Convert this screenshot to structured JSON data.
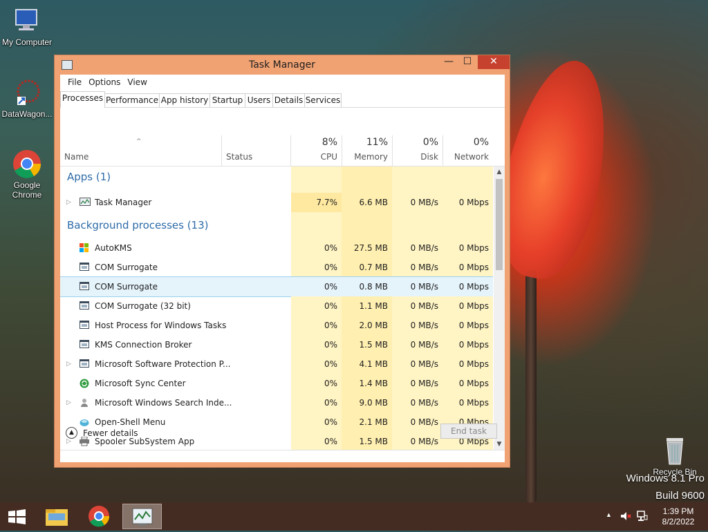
{
  "desktop": {
    "icons": [
      {
        "label": "My Computer",
        "icon": "monitor-icon"
      },
      {
        "label": "DataWagon...",
        "icon": "datawagon-icon"
      },
      {
        "label": "Google Chrome",
        "icon": "chrome-icon"
      },
      {
        "label": "Recycle Bin",
        "icon": "recycle-bin-icon"
      }
    ],
    "watermark": {
      "line1": "Windows 8.1 Pro",
      "line2": "Build 9600"
    }
  },
  "window": {
    "title": "Task Manager",
    "controls": {
      "minimize": "—",
      "maximize": "☐",
      "close": "✕"
    },
    "menu": [
      "File",
      "Options",
      "View"
    ],
    "tabs": [
      "Processes",
      "Performance",
      "App history",
      "Startup",
      "Users",
      "Details",
      "Services"
    ],
    "active_tab": "Processes",
    "columns": {
      "name": "Name",
      "status": "Status",
      "cpu": {
        "pct": "8%",
        "label": "CPU"
      },
      "memory": {
        "pct": "11%",
        "label": "Memory"
      },
      "disk": {
        "pct": "0%",
        "label": "Disk"
      },
      "network": {
        "pct": "0%",
        "label": "Network"
      }
    },
    "groups": [
      {
        "label": "Apps (1)",
        "rows": [
          {
            "name": "Task Manager",
            "expandable": true,
            "icon": "task-manager-icon",
            "cpu": "7.7%",
            "memory": "6.6 MB",
            "disk": "0 MB/s",
            "network": "0 Mbps"
          }
        ]
      },
      {
        "label": "Background processes (13)",
        "rows": [
          {
            "name": "AutoKMS",
            "expandable": false,
            "icon": "windows-logo-icon",
            "cpu": "0%",
            "memory": "27.5 MB",
            "disk": "0 MB/s",
            "network": "0 Mbps"
          },
          {
            "name": "COM Surrogate",
            "expandable": false,
            "icon": "process-window-icon",
            "cpu": "0%",
            "memory": "0.7 MB",
            "disk": "0 MB/s",
            "network": "0 Mbps"
          },
          {
            "name": "COM Surrogate",
            "expandable": false,
            "icon": "process-window-icon",
            "cpu": "0%",
            "memory": "0.8 MB",
            "disk": "0 MB/s",
            "network": "0 Mbps",
            "selected": true
          },
          {
            "name": "COM Surrogate (32 bit)",
            "expandable": false,
            "icon": "process-window-icon",
            "cpu": "0%",
            "memory": "1.1 MB",
            "disk": "0 MB/s",
            "network": "0 Mbps"
          },
          {
            "name": "Host Process for Windows Tasks",
            "expandable": false,
            "icon": "process-window-icon",
            "cpu": "0%",
            "memory": "2.0 MB",
            "disk": "0 MB/s",
            "network": "0 Mbps"
          },
          {
            "name": "KMS Connection Broker",
            "expandable": false,
            "icon": "process-window-icon",
            "cpu": "0%",
            "memory": "1.5 MB",
            "disk": "0 MB/s",
            "network": "0 Mbps"
          },
          {
            "name": "Microsoft Software Protection P...",
            "expandable": true,
            "icon": "process-window-icon",
            "cpu": "0%",
            "memory": "4.1 MB",
            "disk": "0 MB/s",
            "network": "0 Mbps"
          },
          {
            "name": "Microsoft Sync Center",
            "expandable": false,
            "icon": "sync-icon",
            "cpu": "0%",
            "memory": "1.4 MB",
            "disk": "0 MB/s",
            "network": "0 Mbps"
          },
          {
            "name": "Microsoft Windows Search Inde...",
            "expandable": true,
            "icon": "search-indexer-icon",
            "cpu": "0%",
            "memory": "9.0 MB",
            "disk": "0 MB/s",
            "network": "0 Mbps"
          },
          {
            "name": "Open-Shell Menu",
            "expandable": false,
            "icon": "open-shell-icon",
            "cpu": "0%",
            "memory": "2.1 MB",
            "disk": "0 MB/s",
            "network": "0 Mbps"
          },
          {
            "name": "Spooler SubSystem App",
            "expandable": true,
            "icon": "printer-icon",
            "cpu": "0%",
            "memory": "1.5 MB",
            "disk": "0 MB/s",
            "network": "0 Mbps"
          }
        ]
      }
    ],
    "footer": {
      "fewer_details": "Fewer details",
      "end_task": "End task"
    }
  },
  "taskbar": {
    "items": [
      "start-button",
      "file-explorer",
      "chrome",
      "task-manager"
    ],
    "clock": {
      "time": "1:39 PM",
      "date": "8/2/2022"
    }
  },
  "colors": {
    "window_frame": "#f0a273",
    "close_button": "#c7412f",
    "group_text": "#2d6ba8",
    "heat_light": "#fff4c4"
  }
}
